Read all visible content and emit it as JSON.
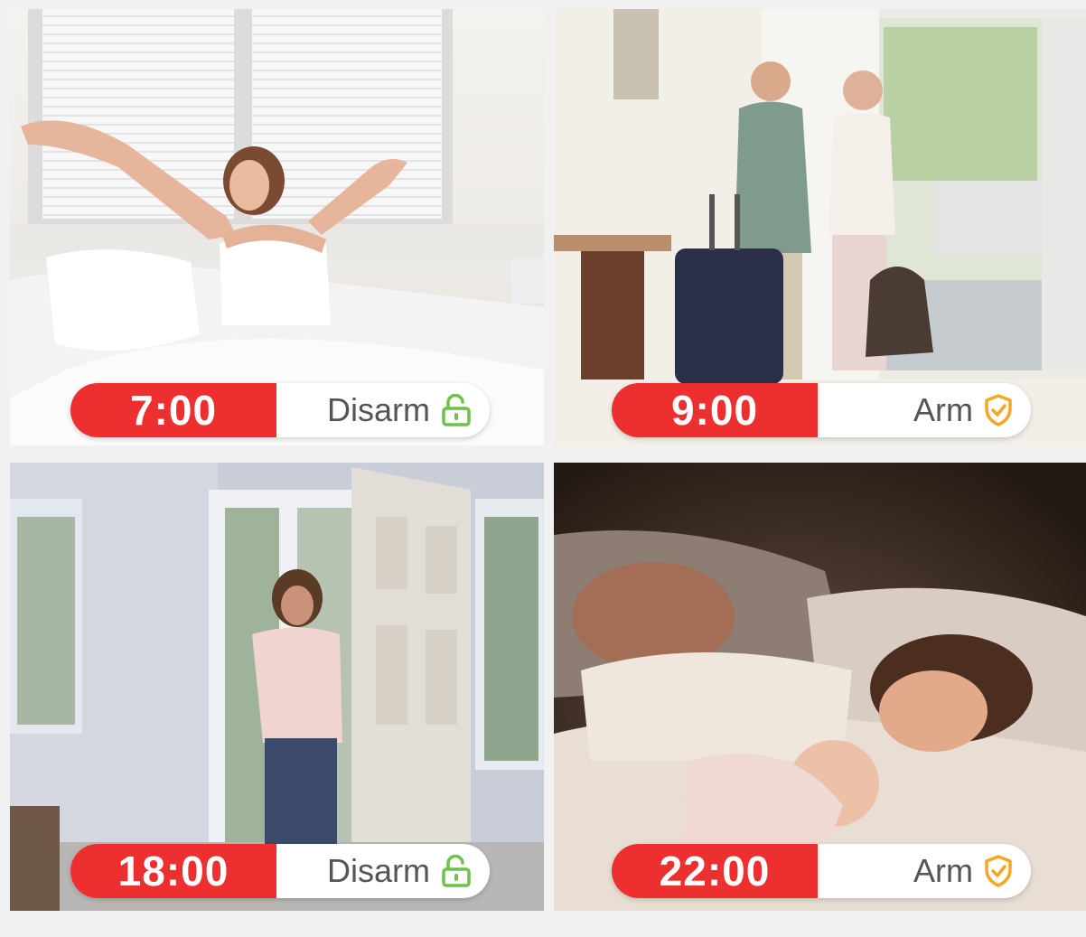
{
  "schedule": [
    {
      "time": "7:00",
      "mode": "Disarm",
      "icon": "unlock-icon",
      "icon_color": "#6cc24a"
    },
    {
      "time": "9:00",
      "mode": "Arm",
      "icon": "shield-check-icon",
      "icon_color": "#f5a623"
    },
    {
      "time": "18:00",
      "mode": "Disarm",
      "icon": "unlock-icon",
      "icon_color": "#6cc24a"
    },
    {
      "time": "22:00",
      "mode": "Arm",
      "icon": "shield-check-icon",
      "icon_color": "#f5a623"
    }
  ],
  "colors": {
    "time_badge": "#ee2f2f",
    "pill_bg": "#ffffff"
  }
}
